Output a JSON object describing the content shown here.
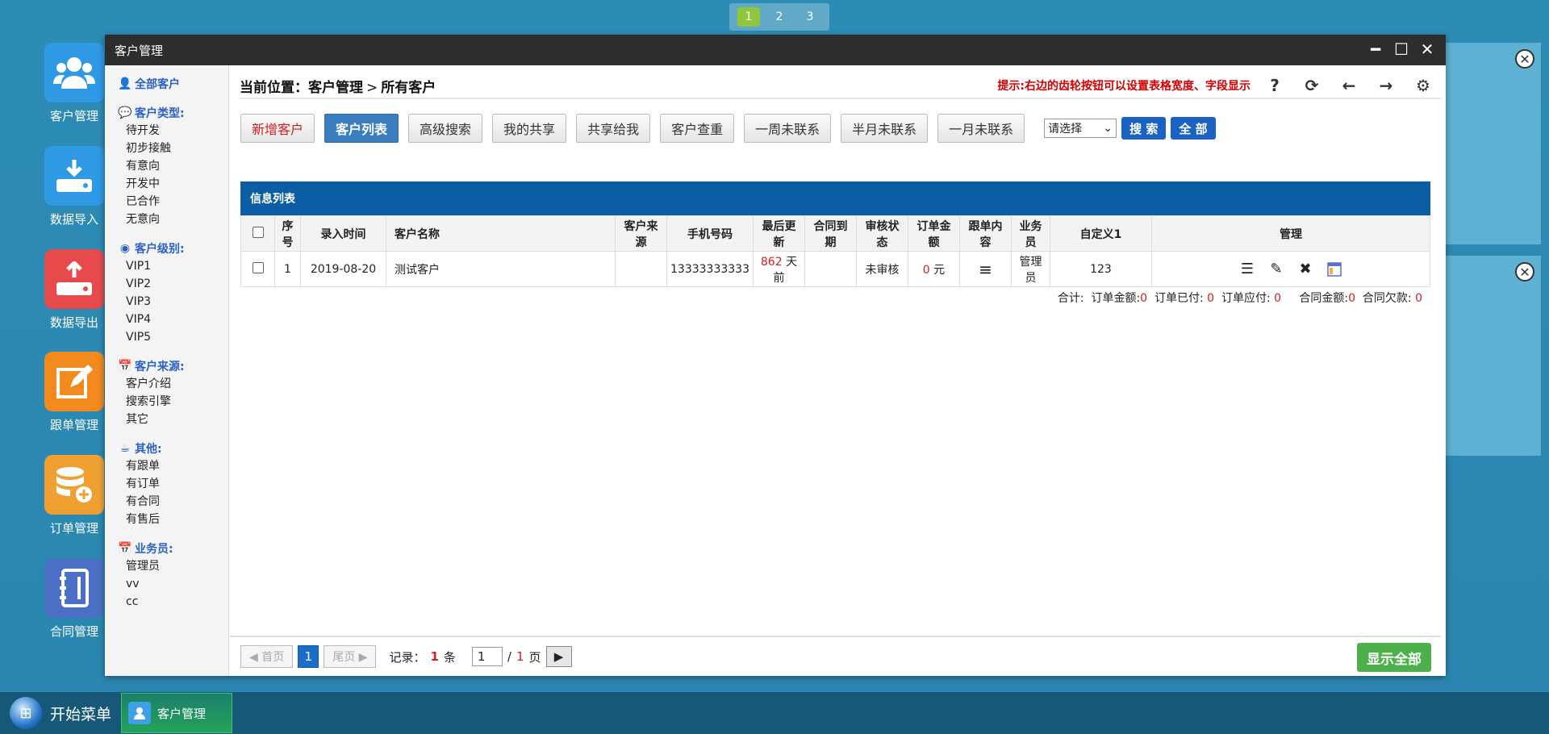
{
  "workspaces": [
    "1",
    "2",
    "3"
  ],
  "desktop_icons": [
    {
      "label": "客户管理",
      "icon": "users-icon",
      "color": "#2e9ae6"
    },
    {
      "label": "数据导入",
      "icon": "import-icon",
      "color": "#2e9ae6"
    },
    {
      "label": "数据导出",
      "icon": "export-icon",
      "color": "#e64a4a"
    },
    {
      "label": "跟单管理",
      "icon": "edit-icon",
      "color": "#f28a1d"
    },
    {
      "label": "订单管理",
      "icon": "database-icon",
      "color": "#f0a030"
    },
    {
      "label": "合同管理",
      "icon": "notebook-icon",
      "color": "#4a6fc4"
    }
  ],
  "window": {
    "title": "客户管理",
    "minimize": "━",
    "maximize": "☐",
    "close": "✕"
  },
  "sidebar": {
    "all": "全部客户",
    "groups": [
      {
        "head": "客户类型:",
        "icon": "chat-icon",
        "items": [
          "待开发",
          "初步接触",
          "有意向",
          "开发中",
          "已合作",
          "无意向"
        ]
      },
      {
        "head": "客户级别:",
        "icon": "level-icon",
        "items": [
          "VIP1",
          "VIP2",
          "VIP3",
          "VIP4",
          "VIP5"
        ]
      },
      {
        "head": "客户来源:",
        "icon": "calendar-icon",
        "items": [
          "客户介绍",
          "搜索引擎",
          "其它"
        ]
      },
      {
        "head": "其他:",
        "icon": "cup-icon",
        "items": [
          "有跟单",
          "有订单",
          "有合同",
          "有售后"
        ]
      },
      {
        "head": "业务员:",
        "icon": "calendar-icon",
        "items": [
          "管理员",
          "vv",
          "cc"
        ]
      }
    ]
  },
  "breadcrumb": {
    "prefix": "当前位置：",
    "section": "客户管理",
    "sep": ">",
    "page": "所有客户"
  },
  "tip": "提示:右边的齿轮按钮可以设置表格宽度、字段显示",
  "tools": {
    "help": "?",
    "refresh": "⟳",
    "back": "←",
    "forward": "→",
    "settings": "⚙"
  },
  "buttons": {
    "add": "新增客户",
    "list": "客户列表",
    "advanced": "高级搜索",
    "myshare": "我的共享",
    "shared": "共享给我",
    "dedupe": "客户查重",
    "week": "一周未联系",
    "halfmonth": "半月未联系",
    "month": "一月未联系"
  },
  "select": {
    "value": "请选择"
  },
  "search": "搜 索",
  "all_btn": "全 部",
  "panel_title": "信息列表",
  "table": {
    "headers": [
      "序号",
      "录入时间",
      "客户名称",
      "客户来源",
      "手机号码",
      "最后更新",
      "合同到期",
      "审核状态",
      "订单金额",
      "跟单内容",
      "业务员",
      "自定义1",
      "管理"
    ],
    "rows": [
      {
        "no": "1",
        "date": "2019-08-20",
        "name": "测试客户",
        "source": "",
        "phone": "13333333333",
        "updated_num": "862",
        "updated_unit": "天前",
        "contract": "",
        "status": "未审核",
        "amount_num": "0",
        "amount_unit": "元",
        "followup": "≡",
        "owner": "管理员",
        "custom1": "123"
      }
    ]
  },
  "summary": {
    "label": "合计:",
    "order_total_label": "订单金额:",
    "order_total": "0",
    "order_paid_label": "订单已付:",
    "order_paid": "0",
    "order_due_label": "订单应付:",
    "order_due": "0",
    "contract_total_label": "合同金额:",
    "contract_total": "0",
    "contract_due_label": "合同欠款:",
    "contract_due": "0"
  },
  "pager": {
    "first": "◀ 首页",
    "current": "1",
    "last": "尾页 ▶",
    "records_label": "记录：",
    "records": "1",
    "records_unit": "条",
    "page_input": "1",
    "slash": "/",
    "total_pages": "1",
    "page_unit": "页",
    "go": "▶"
  },
  "show_all": "显示全部",
  "taskbar": {
    "start": "开始菜单",
    "task": "客户管理"
  }
}
